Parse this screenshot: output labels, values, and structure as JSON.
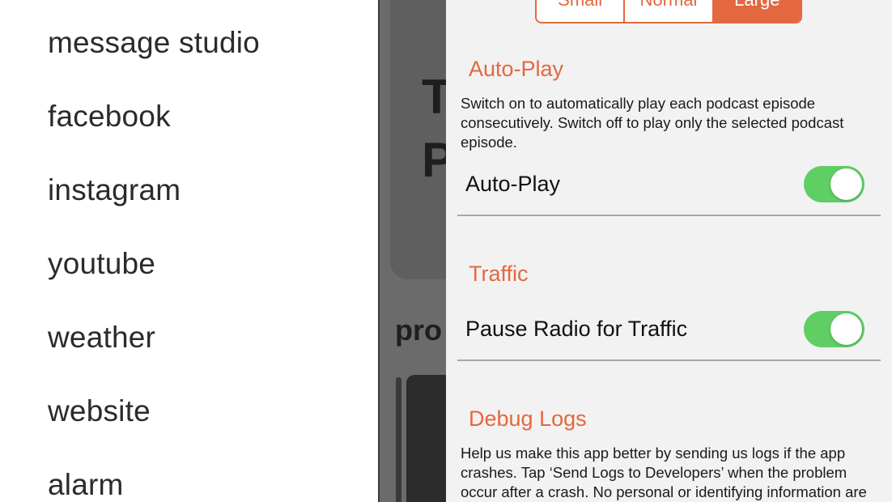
{
  "menu": {
    "items": [
      {
        "label": "message studio"
      },
      {
        "label": "facebook"
      },
      {
        "label": "instagram"
      },
      {
        "label": "youtube"
      },
      {
        "label": "weather"
      },
      {
        "label": "website"
      },
      {
        "label": "alarm"
      }
    ]
  },
  "background": {
    "title_line1": "T",
    "title_line2": "P",
    "section": "pro"
  },
  "settings": {
    "text_size": {
      "options": [
        "Small",
        "Normal",
        "Large"
      ],
      "selected": "Large"
    },
    "autoplay": {
      "heading": "Auto-Play",
      "description": "Switch on to automatically play each podcast episode consecutively. Switch off to play only the selected podcast episode.",
      "label": "Auto-Play",
      "on": true
    },
    "traffic": {
      "heading": "Traffic",
      "label": "Pause Radio for Traffic",
      "on": true
    },
    "debug": {
      "heading": "Debug Logs",
      "description": "Help us make this app better by sending us logs if the app crashes. Tap ‘Send Logs to Developers’ when the problem occur after a crash. No personal or identifying information are"
    }
  },
  "colors": {
    "accent": "#e4683f",
    "toggle_on": "#5fce64",
    "sheet_background": "#f2f2f2",
    "dim_overlay": "#6b6b6b"
  }
}
